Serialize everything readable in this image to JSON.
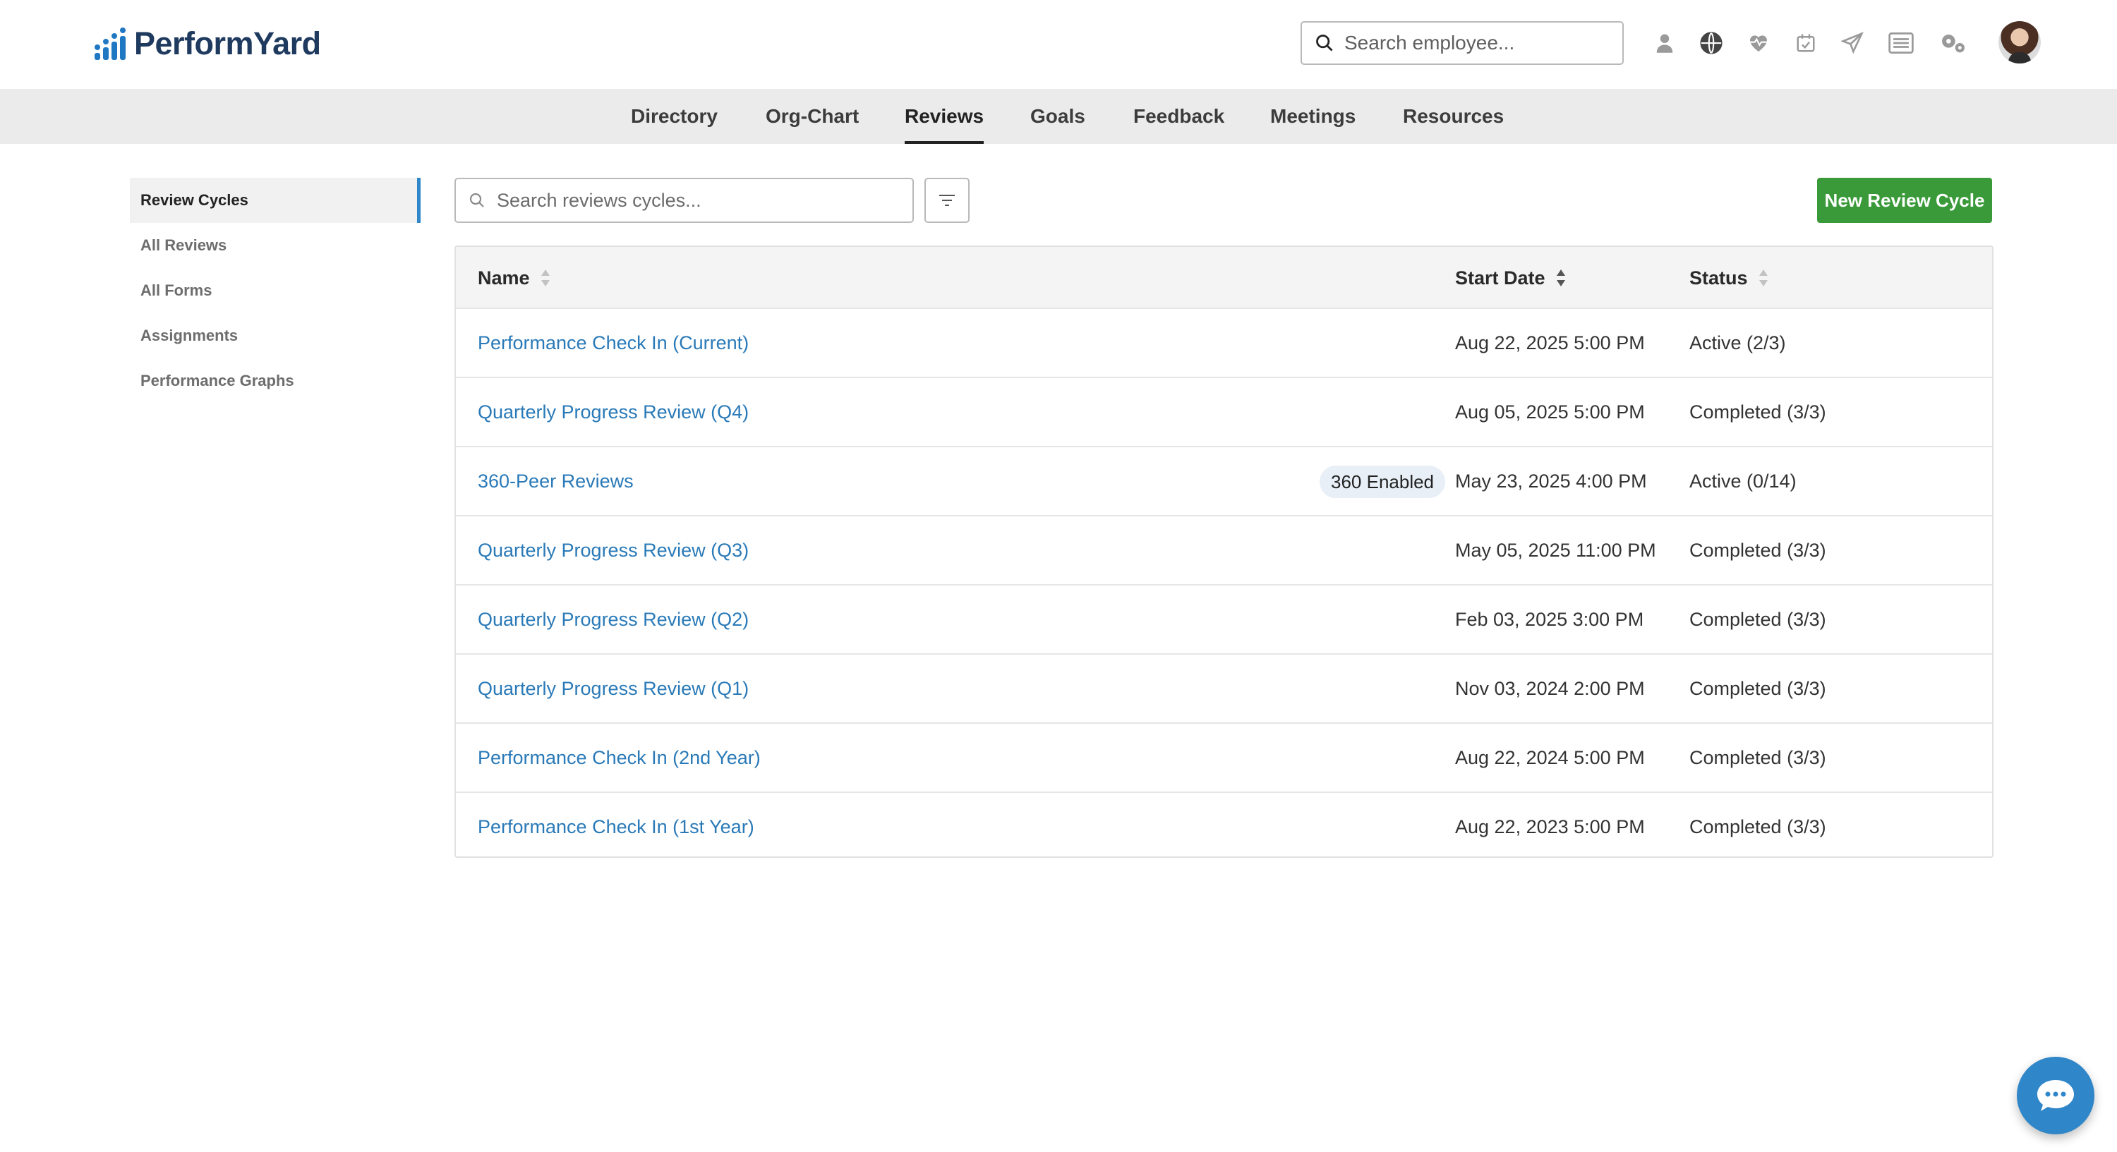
{
  "app": {
    "brand": "PerformYard",
    "accent_color": "#2f86c9",
    "link_color": "#2a7ab8",
    "primary_button_color": "#3a9a3a"
  },
  "header": {
    "employee_search": {
      "placeholder": "Search employee...",
      "value": ""
    },
    "icons": [
      "person-icon",
      "globe-icon",
      "heartbeat-icon",
      "calendar-check-icon",
      "send-icon",
      "list-icon",
      "settings-gears-icon",
      "avatar"
    ]
  },
  "nav": {
    "tabs": [
      {
        "label": "Directory",
        "active": false
      },
      {
        "label": "Org-Chart",
        "active": false
      },
      {
        "label": "Reviews",
        "active": true
      },
      {
        "label": "Goals",
        "active": false
      },
      {
        "label": "Feedback",
        "active": false
      },
      {
        "label": "Meetings",
        "active": false
      },
      {
        "label": "Resources",
        "active": false
      }
    ]
  },
  "sidebar": {
    "items": [
      {
        "label": "Review Cycles",
        "active": true
      },
      {
        "label": "All Reviews",
        "active": false
      },
      {
        "label": "All Forms",
        "active": false
      },
      {
        "label": "Assignments",
        "active": false
      },
      {
        "label": "Performance Graphs",
        "active": false
      }
    ]
  },
  "toolbar": {
    "search": {
      "placeholder": "Search reviews cycles...",
      "value": ""
    },
    "new_button_label": "New Review Cycle"
  },
  "table": {
    "columns": {
      "name": "Name",
      "start_date": "Start Date",
      "status": "Status"
    },
    "rows": [
      {
        "name": "Performance Check In (Current)",
        "badge": "",
        "start_date": "Aug 22, 2025 5:00 PM",
        "status": "Active (2/3)"
      },
      {
        "name": "Quarterly Progress Review (Q4)",
        "badge": "",
        "start_date": "Aug 05, 2025 5:00 PM",
        "status": "Completed (3/3)"
      },
      {
        "name": "360-Peer Reviews",
        "badge": "360 Enabled",
        "start_date": "May 23, 2025 4:00 PM",
        "status": "Active (0/14)"
      },
      {
        "name": "Quarterly Progress Review (Q3)",
        "badge": "",
        "start_date": "May 05, 2025 11:00 PM",
        "status": "Completed (3/3)"
      },
      {
        "name": "Quarterly Progress Review (Q2)",
        "badge": "",
        "start_date": "Feb 03, 2025 3:00 PM",
        "status": "Completed (3/3)"
      },
      {
        "name": "Quarterly Progress Review (Q1)",
        "badge": "",
        "start_date": "Nov 03, 2024 2:00 PM",
        "status": "Completed (3/3)"
      },
      {
        "name": "Performance Check In (2nd Year)",
        "badge": "",
        "start_date": "Aug 22, 2024 5:00 PM",
        "status": "Completed (3/3)"
      },
      {
        "name": "Performance Check In (1st Year)",
        "badge": "",
        "start_date": "Aug 22, 2023 5:00 PM",
        "status": "Completed (3/3)"
      }
    ]
  }
}
